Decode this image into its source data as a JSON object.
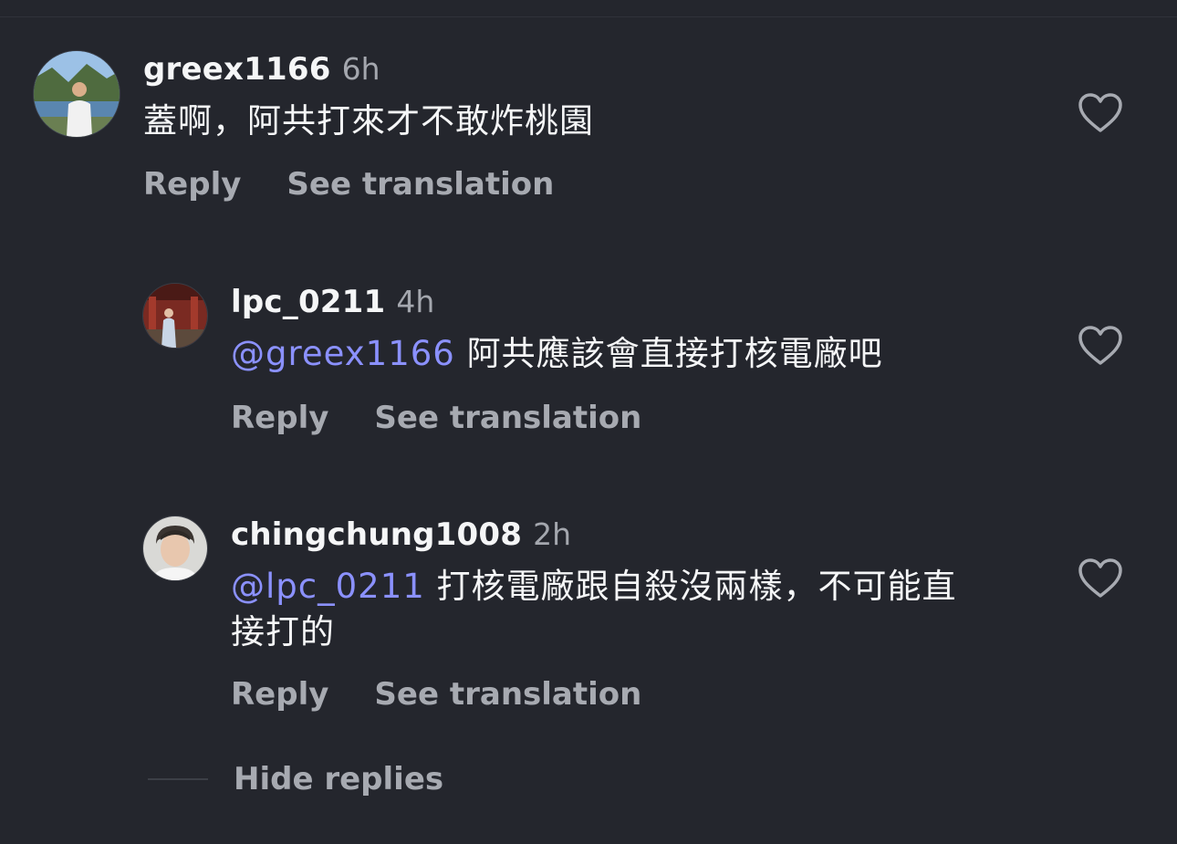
{
  "comments": [
    {
      "username": "greex1166",
      "time": "6h",
      "mention": "",
      "text": "蓋啊，阿共打來才不敢炸桃園",
      "text_cont": "",
      "reply_label": "Reply",
      "translate_label": "See translation",
      "avatar_icon": "avatar-photo",
      "like_icon": "heart-outline-icon"
    },
    {
      "username": "lpc_0211",
      "time": "4h",
      "mention": "@greex1166",
      "text": "阿共應該會直接打核電廠吧",
      "text_cont": "",
      "reply_label": "Reply",
      "translate_label": "See translation",
      "avatar_icon": "avatar-photo",
      "like_icon": "heart-outline-icon"
    },
    {
      "username": "chingchung1008",
      "time": "2h",
      "mention": "@lpc_0211",
      "text": "打核電廠跟自殺沒兩樣，不可能直",
      "text_cont": "接打的",
      "reply_label": "Reply",
      "translate_label": "See translation",
      "avatar_icon": "avatar-photo",
      "like_icon": "heart-outline-icon"
    }
  ],
  "hide_replies_label": "Hide replies",
  "colors": {
    "background": "#24262d",
    "mention": "#8b91ff",
    "secondary_text": "#a7aab1",
    "primary_text": "#f5f6f7"
  }
}
